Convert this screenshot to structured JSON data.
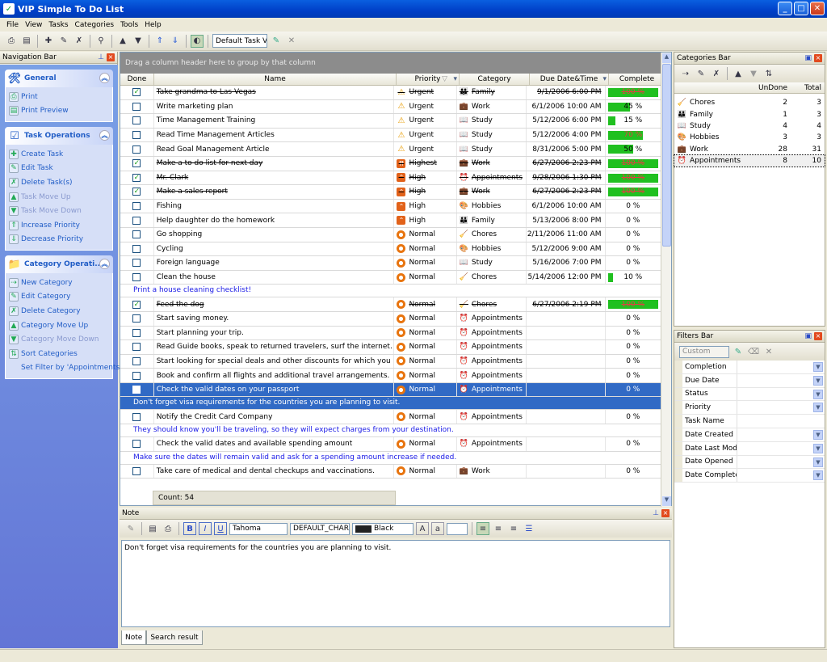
{
  "window": {
    "title": "VIP Simple To Do List"
  },
  "menu": [
    "File",
    "View",
    "Tasks",
    "Categories",
    "Tools",
    "Help"
  ],
  "toolbar": {
    "view_select": "Default Task View"
  },
  "nav": {
    "title": "Navigation Bar",
    "groups": [
      {
        "title": "General",
        "items": [
          {
            "label": "Print",
            "enabled": true
          },
          {
            "label": "Print Preview",
            "enabled": true
          }
        ]
      },
      {
        "title": "Task Operations",
        "items": [
          {
            "label": "Create Task",
            "enabled": true
          },
          {
            "label": "Edit Task",
            "enabled": true
          },
          {
            "label": "Delete Task(s)",
            "enabled": true
          },
          {
            "label": "Task Move Up",
            "enabled": false
          },
          {
            "label": "Task Move Down",
            "enabled": false
          },
          {
            "label": "Increase Priority",
            "enabled": true
          },
          {
            "label": "Decrease Priority",
            "enabled": true
          }
        ]
      },
      {
        "title": "Category Operati...",
        "items": [
          {
            "label": "New Category",
            "enabled": true
          },
          {
            "label": "Edit Category",
            "enabled": true
          },
          {
            "label": "Delete Category",
            "enabled": true
          },
          {
            "label": "Category Move Up",
            "enabled": true
          },
          {
            "label": "Category Move Down",
            "enabled": false
          },
          {
            "label": "Sort Categories",
            "enabled": true
          },
          {
            "label": "Set Filter by 'Appointments'",
            "enabled": true,
            "noicon": true
          }
        ]
      }
    ]
  },
  "grid": {
    "group_hint": "Drag a column header here to group by that column",
    "columns": [
      "Done",
      "Name",
      "Priority",
      "Category",
      "Due Date&Time",
      "Complete"
    ],
    "count": "Count: 54",
    "rows": [
      {
        "done": true,
        "name": "Take grandma to Las Vegas",
        "priority": "Urgent",
        "category": "Family",
        "due": "9/1/2006 6:00 PM",
        "complete": "100 %",
        "pct": 100
      },
      {
        "done": false,
        "name": "Write marketing plan",
        "priority": "Urgent",
        "category": "Work",
        "due": "6/1/2006 10:00 AM",
        "complete": "45 %",
        "pct": 45
      },
      {
        "done": false,
        "name": "Time Management Training",
        "priority": "Urgent",
        "category": "Study",
        "due": "5/12/2006 6:00 PM",
        "complete": "15 %",
        "pct": 15
      },
      {
        "done": false,
        "name": "Read Time Management Articles",
        "priority": "Urgent",
        "category": "Study",
        "due": "5/12/2006 4:00 PM",
        "complete": "70 %",
        "pct": 70
      },
      {
        "done": false,
        "name": "Read Goal Management Article",
        "priority": "Urgent",
        "category": "Study",
        "due": "8/31/2006 5:00 PM",
        "complete": "50 %",
        "pct": 50
      },
      {
        "done": true,
        "name": "Make a to do list for next day",
        "priority": "Highest",
        "category": "Work",
        "due": "6/27/2006 2:23 PM",
        "complete": "100 %",
        "pct": 100
      },
      {
        "done": true,
        "name": "Mr. Clark",
        "priority": "High",
        "category": "Appointments",
        "due": "9/28/2006 1:30 PM",
        "complete": "100 %",
        "pct": 100
      },
      {
        "done": true,
        "name": "Make a sales report",
        "priority": "High",
        "category": "Work",
        "due": "6/27/2006 2:23 PM",
        "complete": "100 %",
        "pct": 100
      },
      {
        "done": false,
        "name": "Fishing",
        "priority": "High",
        "category": "Hobbies",
        "due": "6/1/2006 10:00 AM",
        "complete": "0 %",
        "pct": 0
      },
      {
        "done": false,
        "name": "Help daughter do the homework",
        "priority": "High",
        "category": "Family",
        "due": "5/13/2006 8:00 PM",
        "complete": "0 %",
        "pct": 0
      },
      {
        "done": false,
        "name": "Go shopping",
        "priority": "Normal",
        "category": "Chores",
        "due": "2/11/2006 11:00 AM",
        "complete": "0 %",
        "pct": 0
      },
      {
        "done": false,
        "name": "Cycling",
        "priority": "Normal",
        "category": "Hobbies",
        "due": "5/12/2006 9:00 AM",
        "complete": "0 %",
        "pct": 0
      },
      {
        "done": false,
        "name": "Foreign language",
        "priority": "Normal",
        "category": "Study",
        "due": "5/16/2006 7:00 PM",
        "complete": "0 %",
        "pct": 0
      },
      {
        "done": false,
        "name": "Clean the house",
        "priority": "Normal",
        "category": "Chores",
        "due": "5/14/2006 12:00 PM",
        "complete": "10 %",
        "pct": 10,
        "note": "Print a house cleaning checklist!"
      },
      {
        "done": true,
        "name": "Feed the dog",
        "priority": "Normal",
        "category": "Chores",
        "due": "6/27/2006 2:19 PM",
        "complete": "100 %",
        "pct": 100
      },
      {
        "done": false,
        "name": "Start saving money.",
        "priority": "Normal",
        "category": "Appointments",
        "due": "",
        "complete": "0 %",
        "pct": 0
      },
      {
        "done": false,
        "name": "Start planning your trip.",
        "priority": "Normal",
        "category": "Appointments",
        "due": "",
        "complete": "0 %",
        "pct": 0
      },
      {
        "done": false,
        "name": "Read Guide books, speak to returned travelers, surf the internet.",
        "priority": "Normal",
        "category": "Appointments",
        "due": "",
        "complete": "0 %",
        "pct": 0
      },
      {
        "done": false,
        "name": "Start looking for special deals and other discounts for which you may qualify.",
        "priority": "Normal",
        "category": "Appointments",
        "due": "",
        "complete": "0 %",
        "pct": 0
      },
      {
        "done": false,
        "name": "Book and confirm all flights and additional travel arrangements.",
        "priority": "Normal",
        "category": "Appointments",
        "due": "",
        "complete": "0 %",
        "pct": 0
      },
      {
        "done": false,
        "name": "Check the valid dates on your passport",
        "priority": "Normal",
        "category": "Appointments",
        "due": "",
        "complete": "0 %",
        "pct": 0,
        "selected": true,
        "note": "Don't forget visa requirements for the countries you are planning to visit."
      },
      {
        "done": false,
        "name": "Notify the Credit Card Company",
        "priority": "Normal",
        "category": "Appointments",
        "due": "",
        "complete": "0 %",
        "pct": 0,
        "note": "They should know you'll be traveling, so they will expect charges from your destination."
      },
      {
        "done": false,
        "name": "Check the valid dates and available spending amount",
        "priority": "Normal",
        "category": "Appointments",
        "due": "",
        "complete": "0 %",
        "pct": 0,
        "note": "Make sure the dates will remain valid and ask for a spending amount increase if needed."
      },
      {
        "done": false,
        "name": "Take care of medical and dental checkups and vaccinations.",
        "priority": "Normal",
        "category": "Work",
        "due": "",
        "complete": "0 %",
        "pct": 0
      }
    ]
  },
  "note_panel": {
    "title": "Note",
    "font": "Tahoma",
    "charset": "DEFAULT_CHARSET",
    "color": "Black",
    "text": "Don't forget visa requirements for the countries you are planning to visit.",
    "tabs": [
      "Note",
      "Search result"
    ]
  },
  "categories": {
    "title": "Categories Bar",
    "headers": [
      "",
      "UnDone",
      "Total"
    ],
    "rows": [
      {
        "name": "Chores",
        "undone": "2",
        "total": "3"
      },
      {
        "name": "Family",
        "undone": "1",
        "total": "3"
      },
      {
        "name": "Study",
        "undone": "4",
        "total": "4"
      },
      {
        "name": "Hobbies",
        "undone": "3",
        "total": "3"
      },
      {
        "name": "Work",
        "undone": "28",
        "total": "31"
      },
      {
        "name": "Appointments",
        "undone": "8",
        "total": "10",
        "selected": true
      }
    ]
  },
  "filters": {
    "title": "Filters Bar",
    "preset": "Custom",
    "items": [
      "Completion",
      "Due Date",
      "Status",
      "Priority",
      "Task Name",
      "Date Created",
      "Date Last Modified",
      "Date Opened",
      "Date Completed"
    ]
  }
}
